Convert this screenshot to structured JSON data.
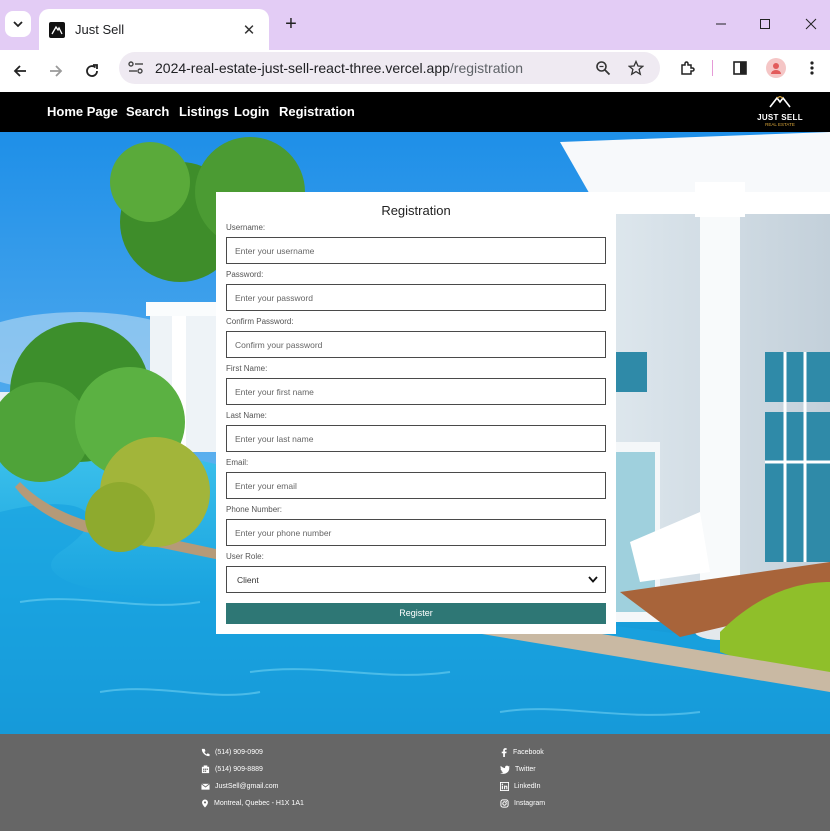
{
  "browser": {
    "tab_title": "Just Sell",
    "new_tab_symbol": "+",
    "url_host": "2024-real-estate-just-sell-react-three.vercel.app",
    "url_path": "/registration"
  },
  "nav": {
    "links": [
      "Home Page",
      "Search",
      "Listings",
      "Login",
      "Registration"
    ],
    "brand_name": "JUST SELL",
    "brand_sub": "REAL ESTATE"
  },
  "form": {
    "title": "Registration",
    "fields": [
      {
        "label": "Username:",
        "placeholder": "Enter your username"
      },
      {
        "label": "Password:",
        "placeholder": "Enter your password"
      },
      {
        "label": "Confirm Password:",
        "placeholder": "Confirm your password"
      },
      {
        "label": "First Name:",
        "placeholder": "Enter your first name"
      },
      {
        "label": "Last Name:",
        "placeholder": "Enter your last name"
      },
      {
        "label": "Email:",
        "placeholder": "Enter your email"
      },
      {
        "label": "Phone Number:",
        "placeholder": "Enter your phone number"
      }
    ],
    "role_label": "User Role:",
    "role_value": "Client",
    "submit_label": "Register",
    "button_color": "#2e7775"
  },
  "footer": {
    "contact": [
      {
        "icon": "phone-icon",
        "text": "(514) 909-0909"
      },
      {
        "icon": "fax-icon",
        "text": "(514) 909-8889"
      },
      {
        "icon": "email-icon",
        "text": "JustSell@gmail.com"
      },
      {
        "icon": "location-pin-icon",
        "text": "Montreal, Quebec - H1X 1A1"
      }
    ],
    "social": [
      {
        "icon": "facebook-icon",
        "text": "Facebook"
      },
      {
        "icon": "twitter-icon",
        "text": "Twitter"
      },
      {
        "icon": "linkedin-icon",
        "text": "LinkedIn"
      },
      {
        "icon": "instagram-icon",
        "text": "Instagram"
      }
    ]
  }
}
